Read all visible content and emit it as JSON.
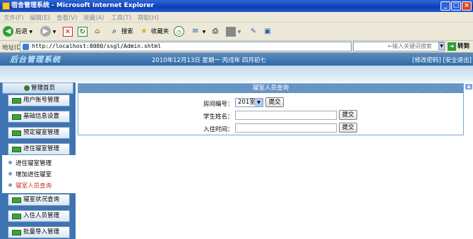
{
  "window": {
    "title": "宿舍管理系统 - Microsoft Internet Explorer"
  },
  "menu": [
    "文件(F)",
    "编辑(E)",
    "查看(V)",
    "收藏(A)",
    "工具(T)",
    "帮助(H)"
  ],
  "toolbar": {
    "back": "后退",
    "search": "搜索",
    "favorites": "收藏夹"
  },
  "address": {
    "label": "地址(D)",
    "url": "http://localhost:8080/ssgl/Admin.shtml",
    "search_placeholder": "←输入关键词搜索",
    "go": "转到"
  },
  "header": {
    "brand": "后台管理系统",
    "date": "2010年12月13日 星期一 丙戌年 四月初七",
    "change_password": "[修改密码]",
    "logout": "[安全退出]"
  },
  "sidebar": {
    "heading": "管理首页",
    "top_buttons": [
      "用户账号管理",
      "基础信息设置",
      "预定寝室管理",
      "进住寝室管理"
    ],
    "sub_items": [
      "进住寝室管理",
      "增加进住寝室",
      "寝室人员查询"
    ],
    "bottom_buttons": [
      "寝室状况查询",
      "入住人员管理",
      "批量导入管理"
    ]
  },
  "panel": {
    "title": "寝室人员查询",
    "room_label": "房间编号：",
    "room_value": "201室",
    "name_label": "学生姓名：",
    "date_label": "入住时间：",
    "submit": "提交"
  }
}
